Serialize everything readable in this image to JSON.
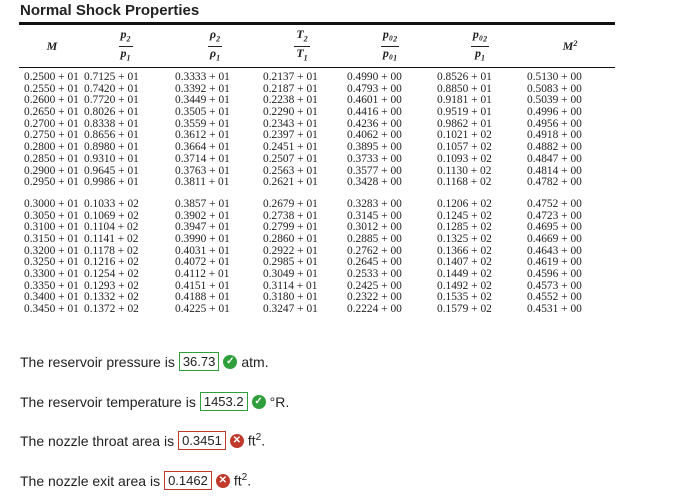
{
  "title": "Normal Shock Properties",
  "headers": [
    {
      "kind": "plain",
      "text": "M"
    },
    {
      "kind": "frac",
      "num": "p",
      "num_sub": "2",
      "den": "p",
      "den_sub": "1"
    },
    {
      "kind": "frac",
      "num": "ρ",
      "num_sub": "2",
      "den": "ρ",
      "den_sub": "1"
    },
    {
      "kind": "frac",
      "num": "T",
      "num_sub": "2",
      "den": "T",
      "den_sub": "1"
    },
    {
      "kind": "frac",
      "num": "p₀",
      "num_sub": "2",
      "den": "p₀",
      "den_sub": "1"
    },
    {
      "kind": "frac",
      "num": "p₀",
      "num_sub": "2",
      "den": "p",
      "den_sub": "1"
    },
    {
      "kind": "plain",
      "text": "M",
      "sub": "2"
    }
  ],
  "groups": [
    [
      [
        "0.2500 + 01",
        "0.7125 + 01",
        "0.3333 + 01",
        "0.2137 + 01",
        "0.4990 + 00",
        "0.8526 + 01",
        "0.5130 + 00"
      ],
      [
        "0.2550 + 01",
        "0.7420 + 01",
        "0.3392 + 01",
        "0.2187 + 01",
        "0.4793 + 00",
        "0.8850 + 01",
        "0.5083 + 00"
      ],
      [
        "0.2600 + 01",
        "0.7720 + 01",
        "0.3449 + 01",
        "0.2238 + 01",
        "0.4601 + 00",
        "0.9181 + 01",
        "0.5039 + 00"
      ],
      [
        "0.2650 + 01",
        "0.8026 + 01",
        "0.3505 + 01",
        "0.2290 + 01",
        "0.4416 + 00",
        "0.9519 + 01",
        "0.4996 + 00"
      ],
      [
        "0.2700 + 01",
        "0.8338 + 01",
        "0.3559 + 01",
        "0.2343 + 01",
        "0.4236 + 00",
        "0.9862 + 01",
        "0.4956 + 00"
      ],
      [
        "0.2750 + 01",
        "0.8656 + 01",
        "0.3612 + 01",
        "0.2397 + 01",
        "0.4062 + 00",
        "0.1021 + 02",
        "0.4918 + 00"
      ],
      [
        "0.2800 + 01",
        "0.8980 + 01",
        "0.3664 + 01",
        "0.2451 + 01",
        "0.3895 + 00",
        "0.1057 + 02",
        "0.4882 + 00"
      ],
      [
        "0.2850 + 01",
        "0.9310 + 01",
        "0.3714 + 01",
        "0.2507 + 01",
        "0.3733 + 00",
        "0.1093 + 02",
        "0.4847 + 00"
      ],
      [
        "0.2900 + 01",
        "0.9645 + 01",
        "0.3763 + 01",
        "0.2563 + 01",
        "0.3577 + 00",
        "0.1130 + 02",
        "0.4814 + 00"
      ],
      [
        "0.2950 + 01",
        "0.9986 + 01",
        "0.3811 + 01",
        "0.2621 + 01",
        "0.3428 + 00",
        "0.1168 + 02",
        "0.4782 + 00"
      ]
    ],
    [
      [
        "0.3000 + 01",
        "0.1033 + 02",
        "0.3857 + 01",
        "0.2679 + 01",
        "0.3283 + 00",
        "0.1206 + 02",
        "0.4752 + 00"
      ],
      [
        "0.3050 + 01",
        "0.1069 + 02",
        "0.3902 + 01",
        "0.2738 + 01",
        "0.3145 + 00",
        "0.1245 + 02",
        "0.4723 + 00"
      ],
      [
        "0.3100 + 01",
        "0.1104 + 02",
        "0.3947 + 01",
        "0.2799 + 01",
        "0.3012 + 00",
        "0.1285 + 02",
        "0.4695 + 00"
      ],
      [
        "0.3150 + 01",
        "0.1141 + 02",
        "0.3990 + 01",
        "0.2860 + 01",
        "0.2885 + 00",
        "0.1325 + 02",
        "0.4669 + 00"
      ],
      [
        "0.3200 + 01",
        "0.1178 + 02",
        "0.4031 + 01",
        "0.2922 + 01",
        "0.2762 + 00",
        "0.1366 + 02",
        "0.4643 + 00"
      ],
      [
        "0.3250 + 01",
        "0.1216 + 02",
        "0.4072 + 01",
        "0.2985 + 01",
        "0.2645 + 00",
        "0.1407 + 02",
        "0.4619 + 00"
      ],
      [
        "0.3300 + 01",
        "0.1254 + 02",
        "0.4112 + 01",
        "0.3049 + 01",
        "0.2533 + 00",
        "0.1449 + 02",
        "0.4596 + 00"
      ],
      [
        "0.3350 + 01",
        "0.1293 + 02",
        "0.4151 + 01",
        "0.3114 + 01",
        "0.2425 + 00",
        "0.1492 + 02",
        "0.4573 + 00"
      ],
      [
        "0.3400 + 01",
        "0.1332 + 02",
        "0.4188 + 01",
        "0.3180 + 01",
        "0.2322 + 00",
        "0.1535 + 02",
        "0.4552 + 00"
      ],
      [
        "0.3450 + 01",
        "0.1372 + 02",
        "0.4225 + 01",
        "0.3247 + 01",
        "0.2224 + 00",
        "0.1579 + 02",
        "0.4531 + 00"
      ]
    ]
  ],
  "answers": [
    {
      "label": "The reservoir pressure is",
      "value": "36.73",
      "status": "correct",
      "status_icon": "check-circle-icon",
      "unit": "atm.",
      "unit_sup": ""
    },
    {
      "label": "The reservoir temperature is",
      "value": "1453.2",
      "status": "correct",
      "status_icon": "check-circle-icon",
      "unit": "°R.",
      "unit_sup": ""
    },
    {
      "label": "The nozzle throat area is",
      "value": "0.3451",
      "status": "incorrect",
      "status_icon": "x-circle-icon",
      "unit": "ft",
      "unit_sup": "2",
      "unit_after": "."
    },
    {
      "label": "The nozzle exit area is",
      "value": "0.1462",
      "status": "incorrect",
      "status_icon": "x-circle-icon",
      "unit": "ft",
      "unit_sup": "2",
      "unit_after": "."
    }
  ],
  "colors": {
    "correct": "#2e9f3a",
    "incorrect": "#c0392b"
  }
}
